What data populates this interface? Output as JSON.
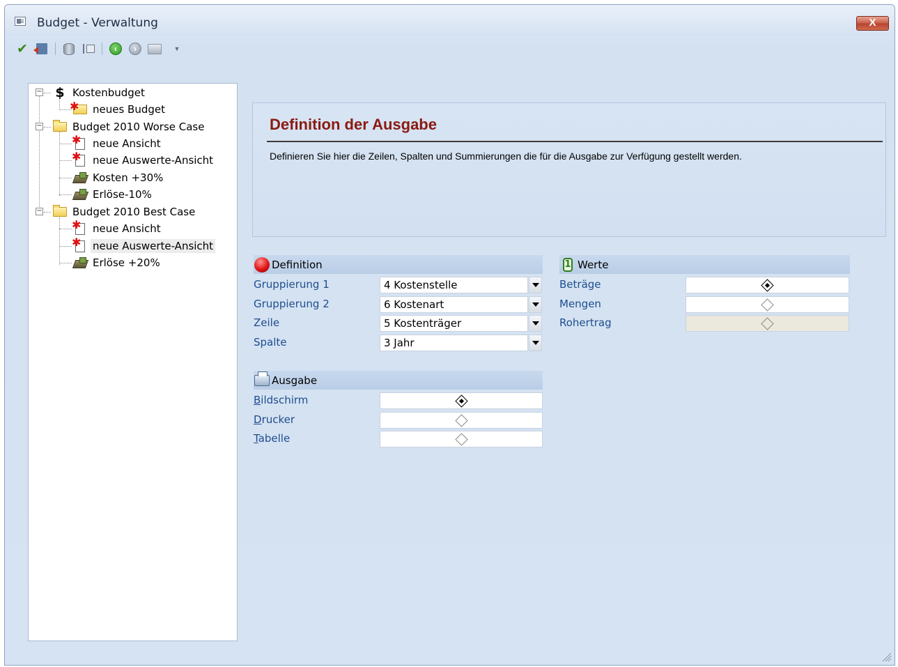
{
  "window": {
    "title": "Budget - Verwaltung",
    "close_label": "X"
  },
  "toolbar": {
    "items": [
      "check-icon",
      "exit-icon",
      "database-icon",
      "tree-icon",
      "back-icon",
      "forward-icon",
      "monitor-icon",
      "dropdown-icon"
    ]
  },
  "tree": {
    "items": [
      {
        "label": "Kostenbudget",
        "icon": "dollar-icon",
        "level": 0,
        "expander": "−"
      },
      {
        "label": "neues Budget",
        "icon": "new-folder-icon",
        "level": 1
      },
      {
        "label": "Budget 2010 Worse Case",
        "icon": "folder-icon",
        "level": 0,
        "expander": "−"
      },
      {
        "label": "neue Ansicht",
        "icon": "new-document-icon",
        "level": 1
      },
      {
        "label": "neue Auswerte-Ansicht",
        "icon": "new-document-icon",
        "level": 1
      },
      {
        "label": "Kosten +30%",
        "icon": "calculator-icon",
        "level": 1
      },
      {
        "label": "Erlöse-10%",
        "icon": "calculator-icon",
        "level": 1
      },
      {
        "label": "Budget 2010 Best Case",
        "icon": "folder-icon",
        "level": 0,
        "expander": "−"
      },
      {
        "label": "neue Ansicht",
        "icon": "new-document-icon",
        "level": 1
      },
      {
        "label": "neue Auswerte-Ansicht",
        "icon": "new-document-icon",
        "level": 1,
        "selected": true
      },
      {
        "label": "Erlöse +20%",
        "icon": "calculator-icon",
        "level": 1
      }
    ]
  },
  "header": {
    "title": "Definition der Ausgabe",
    "description": "Definieren Sie hier die Zeilen, Spalten und Summierungen die für die Ausgabe zur Verfügung gestellt werden."
  },
  "definition": {
    "title": "Definition",
    "rows": [
      {
        "label": "Gruppierung 1",
        "value": "4 Kostenstelle"
      },
      {
        "label": "Gruppierung 2",
        "value": "6 Kostenart"
      },
      {
        "label": "Zeile",
        "value": "5 Kostenträger"
      },
      {
        "label": "Spalte",
        "value": "3 Jahr"
      }
    ]
  },
  "werte": {
    "title": "Werte",
    "rows": [
      {
        "label": "Beträge",
        "selected": true
      },
      {
        "label": "Mengen",
        "selected": false
      },
      {
        "label": "Rohertrag",
        "selected": false,
        "disabled": true
      }
    ]
  },
  "ausgabe": {
    "title": "Ausgabe",
    "rows": [
      {
        "label": "Bildschirm",
        "accel": "B",
        "rest": "ildschirm",
        "selected": true
      },
      {
        "label": "Drucker",
        "accel": "D",
        "rest": "rucker",
        "selected": false
      },
      {
        "label": "Tabelle",
        "accel": "T",
        "rest": "abelle",
        "selected": false
      }
    ]
  }
}
